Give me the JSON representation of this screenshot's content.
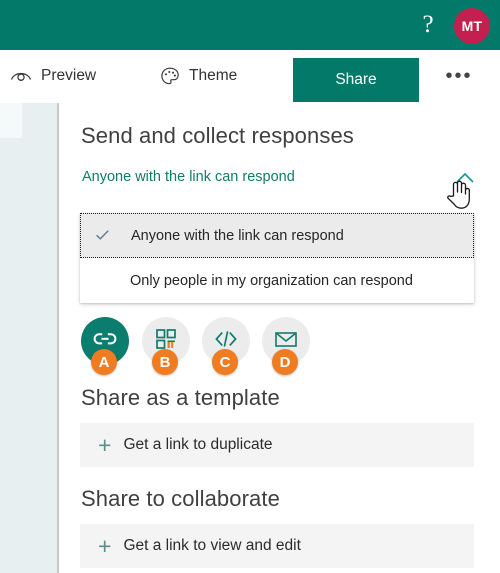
{
  "topbar": {
    "help_label": "?",
    "help_icon": "question-mark-icon",
    "avatar_initials": "MT",
    "brand_color": "#03796a",
    "avatar_color": "#c4204f"
  },
  "commandbar": {
    "preview_label": "Preview",
    "preview_icon": "eye-icon",
    "theme_label": "Theme",
    "theme_icon": "palette-icon",
    "share_label": "Share",
    "more_label": "•••",
    "more_icon": "ellipsis-icon"
  },
  "panel": {
    "send_section_title": "Send and collect responses",
    "audience_link": "Anyone with the link can respond",
    "chevron_icon": "chevron-up-icon",
    "cursor_icon": "pointer-hand-cursor",
    "dropdown": {
      "options": [
        {
          "label": "Anyone with the link can respond",
          "selected": true,
          "check_icon": "checkmark-icon"
        },
        {
          "label": "Only people in my organization can respond",
          "selected": false
        }
      ]
    },
    "share_methods": [
      {
        "icon": "link-icon",
        "badge": "A",
        "active": true
      },
      {
        "icon": "qr-code-icon",
        "badge": "B",
        "active": false
      },
      {
        "icon": "embed-code-icon",
        "badge": "C",
        "active": false
      },
      {
        "icon": "email-envelope-icon",
        "badge": "D",
        "active": false
      }
    ],
    "template_section_title": "Share as a template",
    "template_button_label": "Get a link to duplicate",
    "collaborate_section_title": "Share to collaborate",
    "collaborate_button_label": "Get a link to view and edit",
    "plus_icon": "plus-icon",
    "badge_color": "#ef7c20",
    "accent_color": "#0a7d6e"
  }
}
